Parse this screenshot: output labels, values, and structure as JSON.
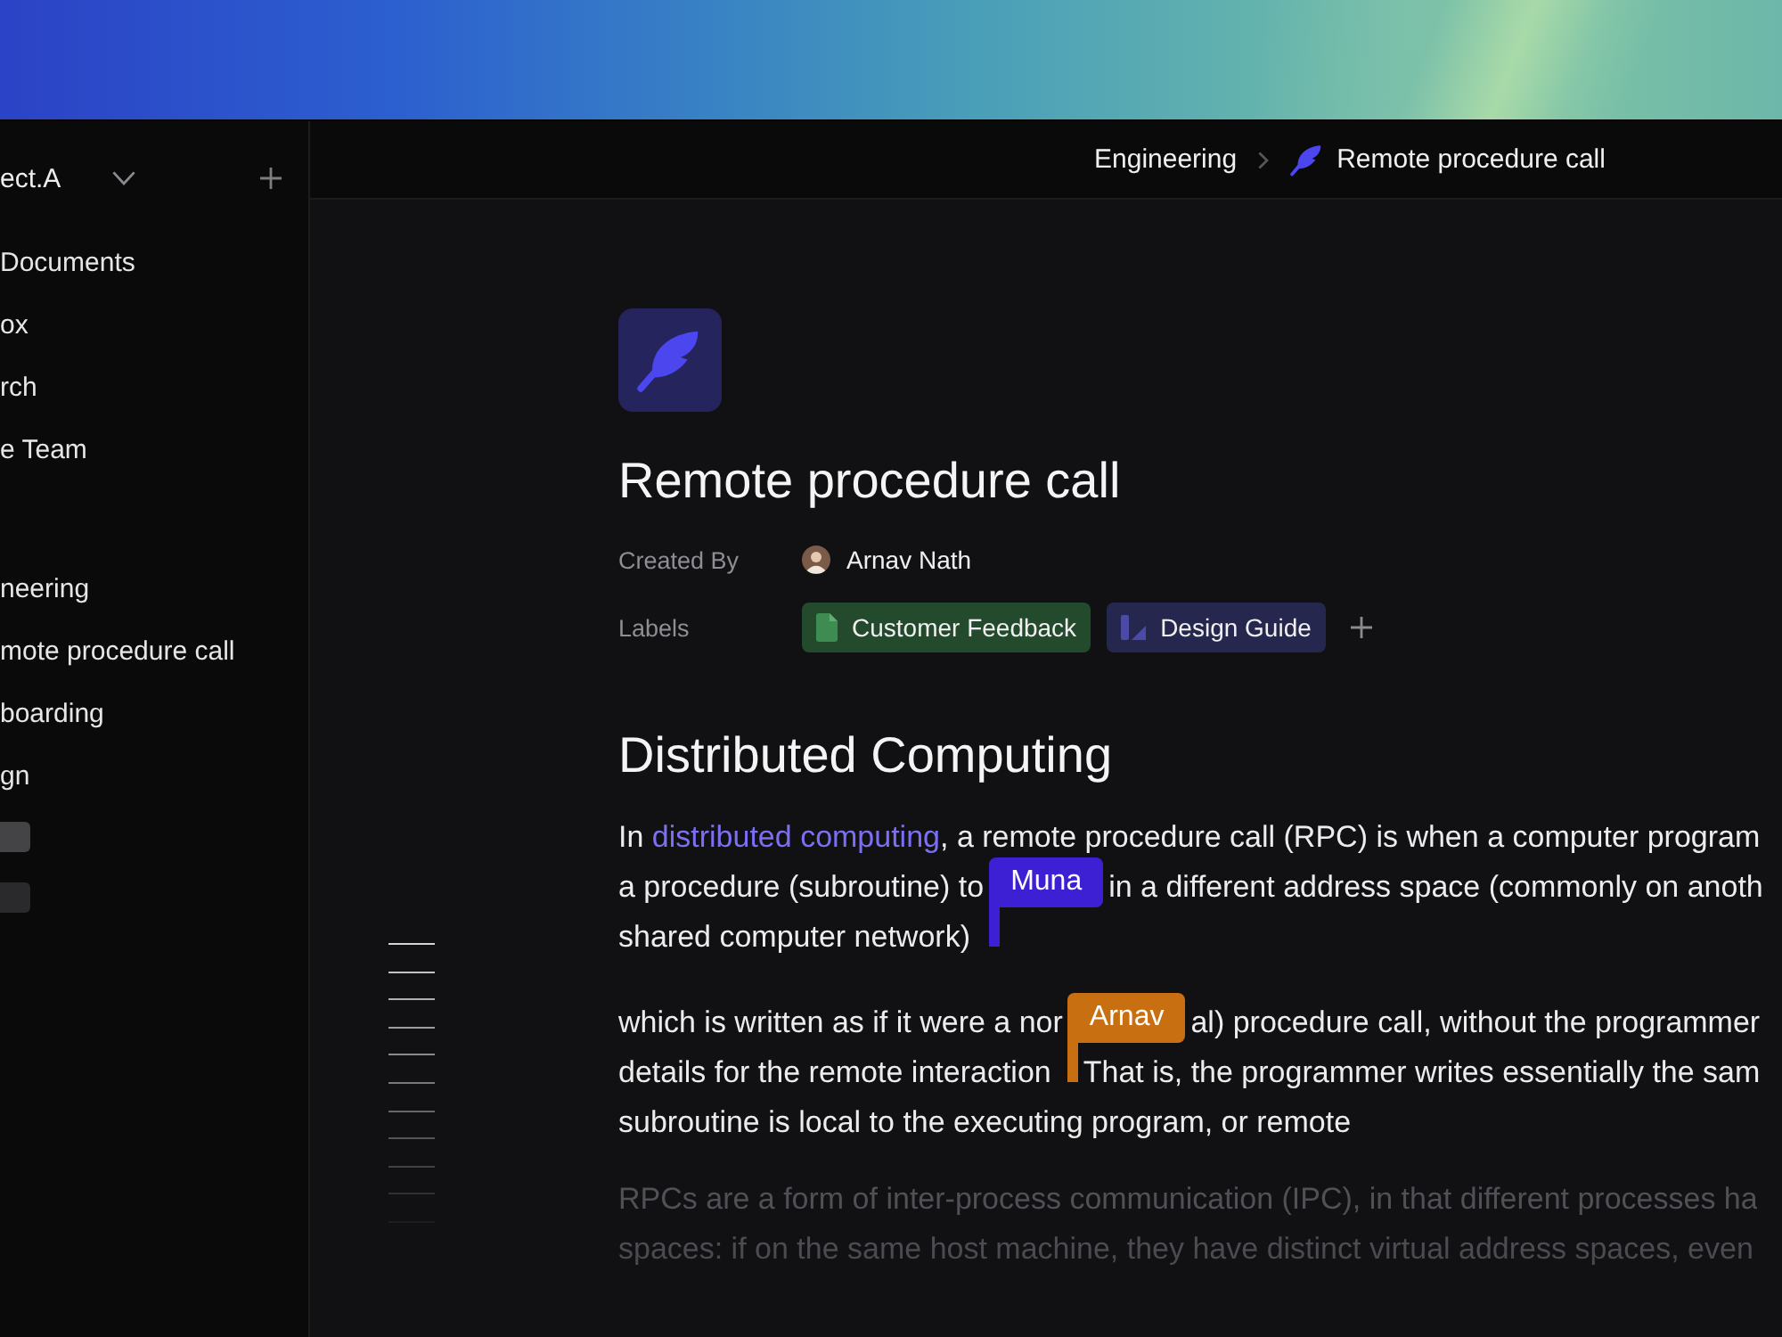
{
  "sidebar": {
    "workspace": "ect.A",
    "items": [
      {
        "label": "Documents"
      },
      {
        "label": "ox"
      },
      {
        "label": "rch"
      },
      {
        "label": "e Team"
      }
    ],
    "pages": [
      {
        "label": "neering"
      },
      {
        "label": "mote procedure call"
      },
      {
        "label": "boarding"
      },
      {
        "label": "gn"
      }
    ]
  },
  "breadcrumb": [
    {
      "label": "Engineering",
      "kind": "folder"
    },
    {
      "label": "Remote procedure call",
      "kind": "page"
    }
  ],
  "document": {
    "title": "Remote procedure call",
    "created_by": {
      "label": "Created By",
      "name": "Arnav Nath"
    },
    "labels": {
      "label": "Labels",
      "tags": [
        {
          "text": "Customer Feedback",
          "kind": "document",
          "color": "#234a2c"
        },
        {
          "text": "Design Guide",
          "kind": "design",
          "color": "#26274f"
        }
      ]
    },
    "heading": "Distributed Computing",
    "paragraphs": [
      {
        "faded": false,
        "lines": [
          {
            "parts": [
              {
                "kind": "text",
                "text": "In "
              },
              {
                "kind": "link",
                "text": "distributed computing"
              },
              {
                "kind": "text",
                "text": ", a remote procedure call (RPC) is when a computer program"
              }
            ]
          },
          {
            "parts": [
              {
                "kind": "text",
                "text": "a procedure (subroutine) to"
              },
              {
                "kind": "cursor",
                "user": "Muna",
                "color": "#3d1fd4"
              },
              {
                "kind": "text",
                "text": "in a different address space (commonly on anoth"
              }
            ]
          },
          {
            "parts": [
              {
                "kind": "text",
                "text": "shared computer network)"
              }
            ]
          }
        ]
      },
      {
        "faded": false,
        "lines": [
          {
            "parts": [
              {
                "kind": "text",
                "text": "which is written as if it were a nor"
              },
              {
                "kind": "cursor",
                "user": "Arnav",
                "color": "#c86f12"
              },
              {
                "kind": "text",
                "text": "al) procedure call, without the programmer"
              }
            ]
          },
          {
            "parts": [
              {
                "kind": "text",
                "text": "details for the remote interaction"
              },
              {
                "kind": "text",
                "text": "That is, the programmer writes essentially the sam"
              }
            ]
          },
          {
            "parts": [
              {
                "kind": "text",
                "text": "subroutine is local to the executing program, or remote"
              }
            ]
          }
        ]
      },
      {
        "faded": true,
        "lines": [
          {
            "parts": [
              {
                "kind": "text",
                "text": "RPCs are a form of inter-process communication (IPC), in that different processes ha"
              }
            ]
          },
          {
            "parts": [
              {
                "kind": "text",
                "text": "spaces: if on the same host machine, they have distinct virtual address spaces, even"
              }
            ]
          }
        ]
      }
    ]
  }
}
